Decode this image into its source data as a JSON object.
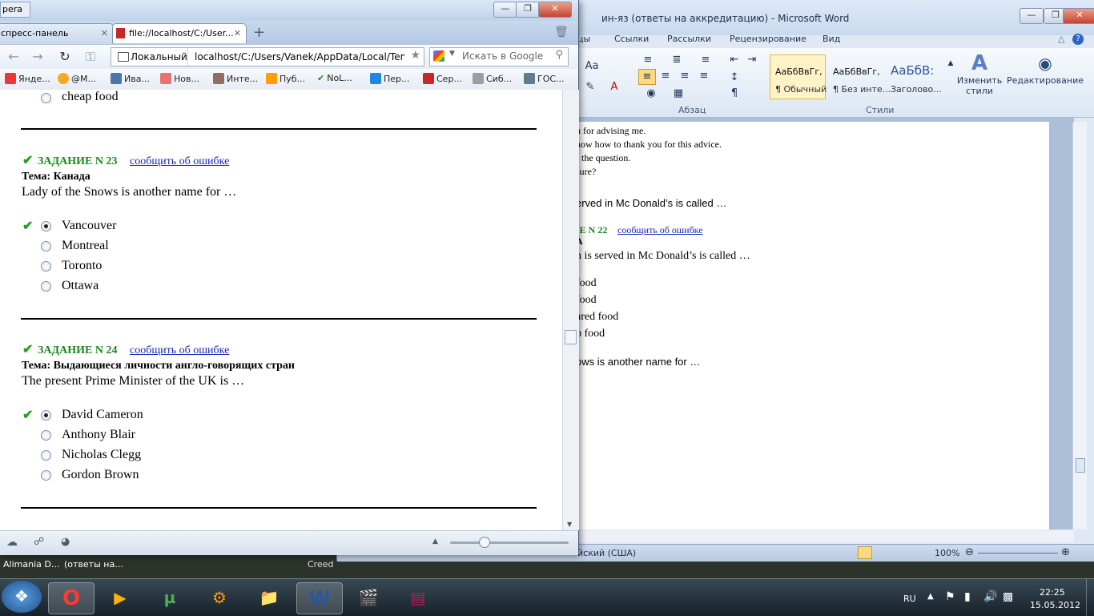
{
  "word": {
    "title": "ин-яз (ответы на аккредитацию)  -  Microsoft Word",
    "tabs": [
      "цы",
      "Ссылки",
      "Рассылки",
      "Рецензирование",
      "Вид"
    ],
    "groups": {
      "paragraph": "Абзац",
      "styles": "Стили"
    },
    "styles": [
      {
        "sample": "АаБбВвГг,",
        "name": "¶ Обычный"
      },
      {
        "sample": "АаБбВвГг,",
        "name": "¶ Без инте..."
      },
      {
        "sample": "АаБбВ:",
        "name": "Заголово..."
      }
    ],
    "change_styles": "Изменить стили",
    "editing": "Редактирование",
    "font_label": "Аа",
    "doc_lines": [
      "u for advising me.",
      "now how to thank you for this advice.",
      "f the question.",
      "sure?",
      "erved in Mc Donald’s is called …",
      "IE N 22",
      "сообщить об ошибке",
      "A",
      "n is served in Mc Donald’s is called …",
      "food",
      " food",
      "ared food",
      "p food",
      "ows is another name for …"
    ],
    "status": {
      "language": "йский (США)",
      "zoom": "100%"
    }
  },
  "browser": {
    "app_chip": "pera",
    "tabs": [
      "спресс-панель",
      "file://localhost/C:/User..."
    ],
    "address_site": "Локальный",
    "address_url": "localhost/C:/Users/Vanek/AppData/Local/Temp/I",
    "search_placeholder": "Искать в Google",
    "bookmarks": [
      "Янде...",
      "@M...",
      "Ива...",
      "Нов...",
      "Инте...",
      "Пуб...",
      "NoL...",
      "Пер...",
      "Сер...",
      "Сиб...",
      "ГОС..."
    ],
    "top_option": "cheap food",
    "tasks": [
      {
        "header": "ЗАДАНИЕ N 23",
        "report": "сообщить об ошибке",
        "theme": "Тема: Канада",
        "question": "Lady of the Snows is another name for …",
        "options": [
          "Vancouver",
          "Montreal",
          "Toronto",
          "Ottawa"
        ],
        "selected_index": 0
      },
      {
        "header": "ЗАДАНИЕ N 24",
        "report": "сообщить об ошибке",
        "theme": "Тема: Выдающиеся личности англо-говорящих стран",
        "question": "The present Prime Minister of the UK is …",
        "options": [
          "David Cameron",
          "Anthony Blair",
          "Nicholas Clegg",
          "Gordon Brown"
        ],
        "selected_index": 0
      }
    ]
  },
  "taskbar": {
    "labels": [
      "Alimania D...",
      "(ответы на...",
      "Creed"
    ],
    "language": "RU",
    "time": "22:25",
    "date": "15.05.2012"
  },
  "colors": {
    "correct_green": "#1a8a1a",
    "link_blue": "#1a24b8",
    "word_blue": "#2b579a"
  }
}
